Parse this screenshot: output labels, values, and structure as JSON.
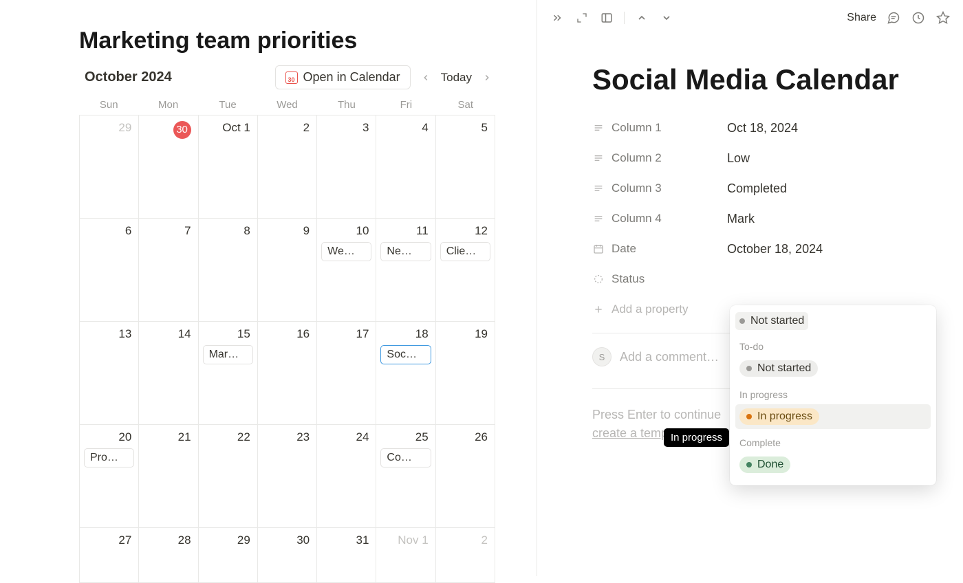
{
  "page_title": "Marketing team priorities",
  "calendar": {
    "month_label": "October 2024",
    "open_in_calendar": "Open in Calendar",
    "cal_icon_num": "30",
    "today": "Today",
    "day_headers": [
      "Sun",
      "Mon",
      "Tue",
      "Wed",
      "Thu",
      "Fri",
      "Sat"
    ],
    "weeks": [
      [
        {
          "n": "29",
          "dim": true
        },
        {
          "n": "30",
          "today": true
        },
        {
          "n": "Oct 1"
        },
        {
          "n": "2"
        },
        {
          "n": "3"
        },
        {
          "n": "4"
        },
        {
          "n": "5"
        }
      ],
      [
        {
          "n": "6"
        },
        {
          "n": "7"
        },
        {
          "n": "8"
        },
        {
          "n": "9"
        },
        {
          "n": "10",
          "ev": "We…"
        },
        {
          "n": "11",
          "ev": "Ne…"
        },
        {
          "n": "12",
          "ev": "Clie…"
        }
      ],
      [
        {
          "n": "13"
        },
        {
          "n": "14"
        },
        {
          "n": "15",
          "ev": "Mar…"
        },
        {
          "n": "16"
        },
        {
          "n": "17"
        },
        {
          "n": "18",
          "ev": "Soc…",
          "sel": true
        },
        {
          "n": "19"
        }
      ],
      [
        {
          "n": "20",
          "ev": "Pro…"
        },
        {
          "n": "21"
        },
        {
          "n": "22"
        },
        {
          "n": "23"
        },
        {
          "n": "24"
        },
        {
          "n": "25",
          "ev": "Co…"
        },
        {
          "n": "26"
        }
      ],
      [
        {
          "n": "27"
        },
        {
          "n": "28"
        },
        {
          "n": "29"
        },
        {
          "n": "30"
        },
        {
          "n": "31"
        },
        {
          "n": "Nov 1",
          "dim": true
        },
        {
          "n": "2",
          "dim": true
        }
      ]
    ]
  },
  "topbar": {
    "share": "Share"
  },
  "detail": {
    "title": "Social Media Calendar",
    "props": [
      {
        "icon": "text",
        "label": "Column 1",
        "value": "Oct 18, 2024"
      },
      {
        "icon": "text",
        "label": "Column 2",
        "value": "Low"
      },
      {
        "icon": "text",
        "label": "Column 3",
        "value": "Completed"
      },
      {
        "icon": "text",
        "label": "Column 4",
        "value": "Mark"
      },
      {
        "icon": "date",
        "label": "Date",
        "value": "October 18, 2024"
      },
      {
        "icon": "status",
        "label": "Status",
        "value": ""
      }
    ],
    "add_property": "Add a property",
    "avatar_letter": "S",
    "comment_placeholder": "Add a comment…",
    "hint_line1a": "Press Enter to continue",
    "hint_line2": "create a template"
  },
  "status_popover": {
    "current": "Not started",
    "groups": [
      {
        "label": "To-do",
        "pill_class": "grey",
        "dot": "grey",
        "option": "Not started"
      },
      {
        "label": "In progress",
        "pill_class": "orange",
        "dot": "orange",
        "option": "In progress",
        "hover": true
      },
      {
        "label": "Complete",
        "pill_class": "green",
        "dot": "green",
        "option": "Done"
      }
    ]
  },
  "tooltip": "In progress"
}
